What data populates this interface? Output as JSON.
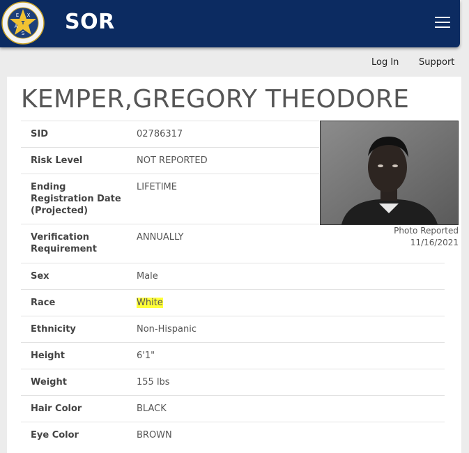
{
  "header": {
    "app_title": "SOR",
    "seal_letters": [
      "E",
      "X",
      "A",
      "S"
    ],
    "seal_letter_t": "T",
    "seal_text": "DEPARTMENT OF PUBLIC SAFETY",
    "colors": {
      "bar": "#0c2b61",
      "accent": "#ffff3a"
    }
  },
  "nav": {
    "login": "Log In",
    "support": "Support"
  },
  "person": {
    "name": "KEMPER,GREGORY THEODORE",
    "photo_caption_line1": "Photo Reported",
    "photo_caption_line2": "11/16/2021"
  },
  "details": [
    {
      "label": "SID",
      "value": "02786317"
    },
    {
      "label": "Risk Level",
      "value": "NOT REPORTED"
    },
    {
      "label": "Ending Registration Date (Projected)",
      "value": "LIFETIME"
    },
    {
      "label": "Verification Requirement",
      "value": "ANNUALLY"
    },
    {
      "label": "Sex",
      "value": "Male"
    },
    {
      "label": "Race",
      "value": "White"
    },
    {
      "label": "Ethnicity",
      "value": "Non-Hispanic"
    },
    {
      "label": "Height",
      "value": "6'1\""
    },
    {
      "label": "Weight",
      "value": "155 lbs"
    },
    {
      "label": "Hair Color",
      "value": "BLACK"
    },
    {
      "label": "Eye Color",
      "value": "BROWN"
    }
  ]
}
